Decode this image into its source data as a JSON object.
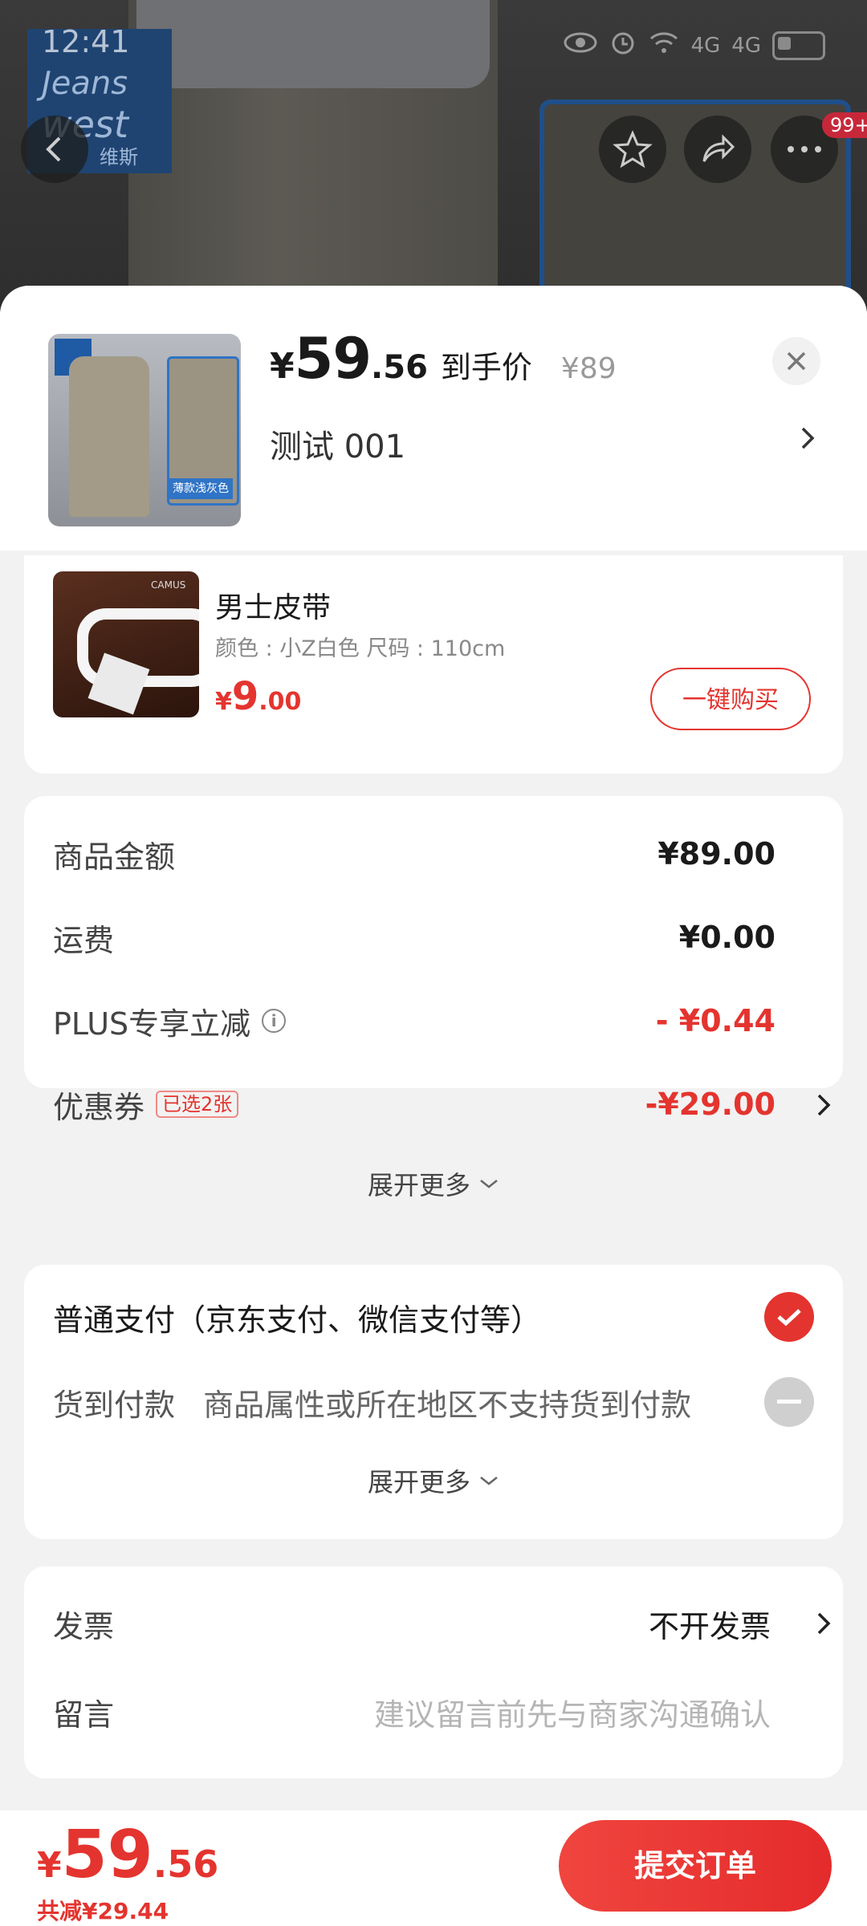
{
  "status_bar": {
    "time": "12:41",
    "net1": "4G",
    "net2": "4G"
  },
  "backdrop": {
    "brand_line1": "Jeans",
    "brand_line2": "west",
    "brand_cn": "维斯",
    "more_badge": "99+"
  },
  "product": {
    "currency": "¥",
    "price_int": "59",
    "price_dec": ".56",
    "price_label": "到手价",
    "original_price": "¥89",
    "variant": "测试  001",
    "thumb_tag": "薄款浅灰色"
  },
  "addon": {
    "name": "男士皮带",
    "attrs": "颜色 : 小Z白色    尺码 : 110cm",
    "currency": "¥",
    "price_int": "9",
    "price_dec": ".00",
    "button": "一键购买",
    "brand": "CAMUS"
  },
  "summary": {
    "goods_label": "商品金额",
    "goods_value": "¥89.00",
    "shipping_label": "运费",
    "shipping_value": "¥0.00",
    "plus_label": "PLUS专享立减",
    "plus_value": "- ¥0.44",
    "coupon_label": "优惠券",
    "coupon_tag": "已选2张",
    "coupon_value": "-¥29.00",
    "expand": "展开更多"
  },
  "payment": {
    "normal": "普通支付（京东支付、微信支付等）",
    "cod_label": "货到付款",
    "cod_note": "商品属性或所在地区不支持货到付款",
    "expand": "展开更多"
  },
  "invoice": {
    "label": "发票",
    "value": "不开发票",
    "message_label": "留言",
    "message_placeholder": "建议留言前先与商家沟通确认"
  },
  "footer": {
    "currency": "¥",
    "total_int": "59",
    "total_dec": ".56",
    "saved": "共减¥29.44",
    "submit": "提交订单"
  },
  "colors": {
    "accent": "#e4342f",
    "sheet_bg": "#f2f2f2",
    "card_bg": "#ffffff"
  }
}
